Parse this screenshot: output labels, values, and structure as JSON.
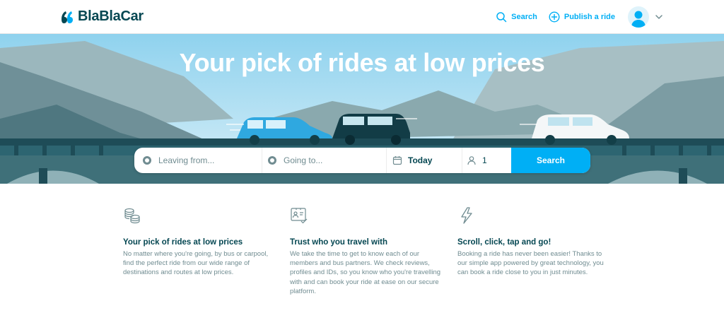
{
  "header": {
    "brand": "BlaBlaCar",
    "nav": {
      "search_label": "Search",
      "publish_label": "Publish a ride"
    }
  },
  "hero": {
    "title": "Your pick of rides at low prices"
  },
  "search": {
    "leaving_placeholder": "Leaving from...",
    "going_placeholder": "Going to...",
    "date_value": "Today",
    "passengers_value": "1",
    "button_label": "Search"
  },
  "features": [
    {
      "icon": "coins-icon",
      "title": "Your pick of rides at low prices",
      "text": "No matter where you're going, by bus or carpool, find the perfect ride from our wide range of destinations and routes at low prices."
    },
    {
      "icon": "id-card-check-icon",
      "title": "Trust who you travel with",
      "text": "We take the time to get to know each of our members and bus partners. We check reviews, profiles and IDs, so you know who you're travelling with and can book your ride at ease on our secure platform."
    },
    {
      "icon": "lightning-icon",
      "title": "Scroll, click, tap and go!",
      "text": "Booking a ride has never been easier! Thanks to our simple app powered by great technology, you can book a ride close to you in just minutes."
    }
  ],
  "colors": {
    "accent": "#00aff5",
    "text_dark": "#054752",
    "text_muted": "#708c91"
  }
}
